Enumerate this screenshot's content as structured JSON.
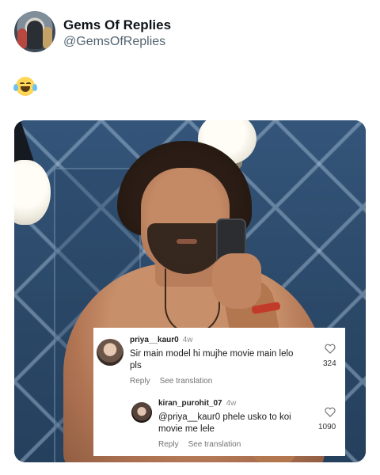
{
  "tweet": {
    "author_name": "Gems Of Replies",
    "author_handle": "@GemsOfReplies",
    "body_emoji": "face-with-tears-of-joy"
  },
  "photo": {
    "description_icon": "mirror-selfie-photo"
  },
  "comments": [
    {
      "username": "priya__kaur0",
      "time": "4w",
      "text": "Sir main model hi mujhe movie main lelo pls",
      "reply_label": "Reply",
      "translation_label": "See translation",
      "likes": "324"
    },
    {
      "username": "kiran_purohit_07",
      "time": "4w",
      "text": "@priya__kaur0 phele usko to koi movie me lele",
      "reply_label": "Reply",
      "translation_label": "See translation",
      "likes": "1090"
    }
  ],
  "colors": {
    "name": "#0f1419",
    "handle": "#536471",
    "tile_blue": "#2c4a6e"
  }
}
